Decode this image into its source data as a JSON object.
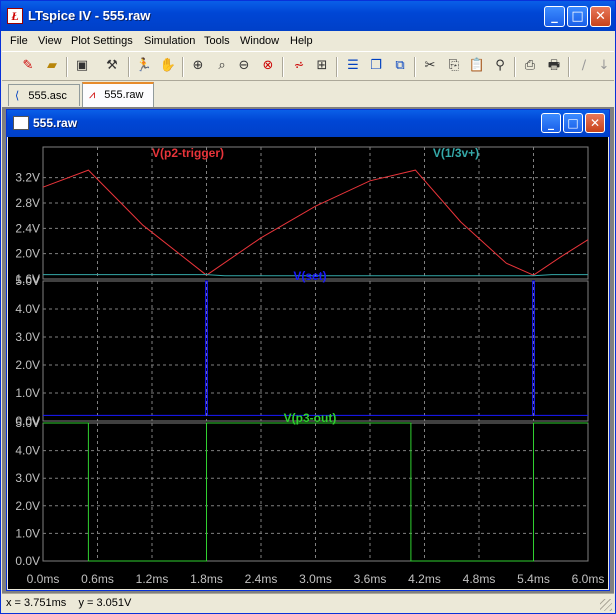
{
  "window": {
    "title": "LTspice IV - 555.raw",
    "minimize_glyph": "_",
    "maximize_glyph": "□",
    "close_glyph": "✕"
  },
  "menu": [
    "File",
    "View",
    "Plot Settings",
    "Simulation",
    "Tools",
    "Window",
    "Help"
  ],
  "toolbar": {
    "icons": [
      "new-schematic-icon",
      "open-icon",
      "save-icon",
      "control-panel-icon",
      "run-icon",
      "pan-icon",
      "zoom-in-icon",
      "zoom-area-icon",
      "zoom-out-icon",
      "zoom-fit-icon",
      "autorange-icon",
      "grid-icon",
      "tile-horizontal-icon",
      "cascade-icon",
      "tile-vertical-icon",
      "cut-icon",
      "copy-icon",
      "paste-icon",
      "find-icon",
      "print-preview-icon",
      "print-icon",
      "wire-icon",
      "arrow-icon"
    ]
  },
  "tabs": [
    {
      "label": "555.asc",
      "icon": "schematic-icon"
    },
    {
      "label": "555.raw",
      "icon": "waveform-icon"
    }
  ],
  "child_window": {
    "title": "555.raw"
  },
  "status": {
    "text": "x = 3.751ms    y = 3.051V"
  },
  "colors": {
    "red": "#e8343a",
    "teal": "#34a8a8",
    "blue": "#1a1aff",
    "green": "#30d030",
    "grid": "#808080"
  },
  "chart_data": [
    {
      "type": "line",
      "xlim": [
        0,
        6.0
      ],
      "ylim": [
        1.6,
        3.4
      ],
      "x_ticks": [
        "0.0ms",
        "0.6ms",
        "1.2ms",
        "1.8ms",
        "2.4ms",
        "3.0ms",
        "3.6ms",
        "4.2ms",
        "4.8ms",
        "5.4ms",
        "6.0ms"
      ],
      "y_ticks": [
        "3.2V",
        "2.8V",
        "2.4V",
        "2.0V",
        "1.6V"
      ],
      "y_tick_values": [
        3.2,
        2.8,
        2.4,
        2.0,
        1.6
      ],
      "series": [
        {
          "name": "V(p2-trigger)",
          "color": "#e8343a",
          "x": [
            0,
            0.5,
            1.1,
            1.8,
            2.4,
            3.0,
            3.6,
            4.1,
            4.6,
            5.1,
            5.4,
            5.7,
            6.0
          ],
          "y": [
            3.05,
            3.32,
            2.45,
            1.66,
            2.25,
            2.75,
            3.15,
            3.32,
            2.5,
            1.85,
            1.66,
            1.95,
            2.22
          ]
        },
        {
          "name": "V(1/3v+)",
          "color": "#34a8a8",
          "x": [
            0,
            1.8,
            2.0,
            5.4,
            5.6,
            6.0
          ],
          "y": [
            1.67,
            1.67,
            1.65,
            1.65,
            1.67,
            1.67
          ]
        }
      ]
    },
    {
      "type": "line",
      "xlim": [
        0,
        6.0
      ],
      "ylim": [
        0,
        5.0
      ],
      "y_ticks": [
        "5.0V",
        "4.0V",
        "3.0V",
        "2.0V",
        "1.0V",
        "0.0V"
      ],
      "y_tick_values": [
        5,
        4,
        3,
        2,
        1,
        0
      ],
      "series": [
        {
          "name": "V(set)",
          "color": "#1a1aff",
          "x": [
            0,
            1.79,
            1.79,
            1.81,
            1.81,
            5.39,
            5.39,
            5.41,
            5.41,
            6.0
          ],
          "y": [
            0.2,
            0.2,
            5.0,
            5.0,
            0.2,
            0.2,
            5.0,
            5.0,
            0.2,
            0.2
          ]
        }
      ]
    },
    {
      "type": "line",
      "xlim": [
        0,
        6.0
      ],
      "ylim": [
        0,
        5.0
      ],
      "y_ticks": [
        "5.0V",
        "4.0V",
        "3.0V",
        "2.0V",
        "1.0V",
        "0.0V"
      ],
      "y_tick_values": [
        5,
        4,
        3,
        2,
        1,
        0
      ],
      "series": [
        {
          "name": "V(p3-out)",
          "color": "#30d030",
          "x": [
            0,
            0.5,
            0.5,
            1.8,
            1.8,
            4.05,
            4.05,
            5.4,
            5.4,
            6.0
          ],
          "y": [
            5.0,
            5.0,
            0.0,
            0.0,
            5.0,
            5.0,
            0.0,
            0.0,
            5.0,
            5.0
          ]
        }
      ]
    }
  ]
}
